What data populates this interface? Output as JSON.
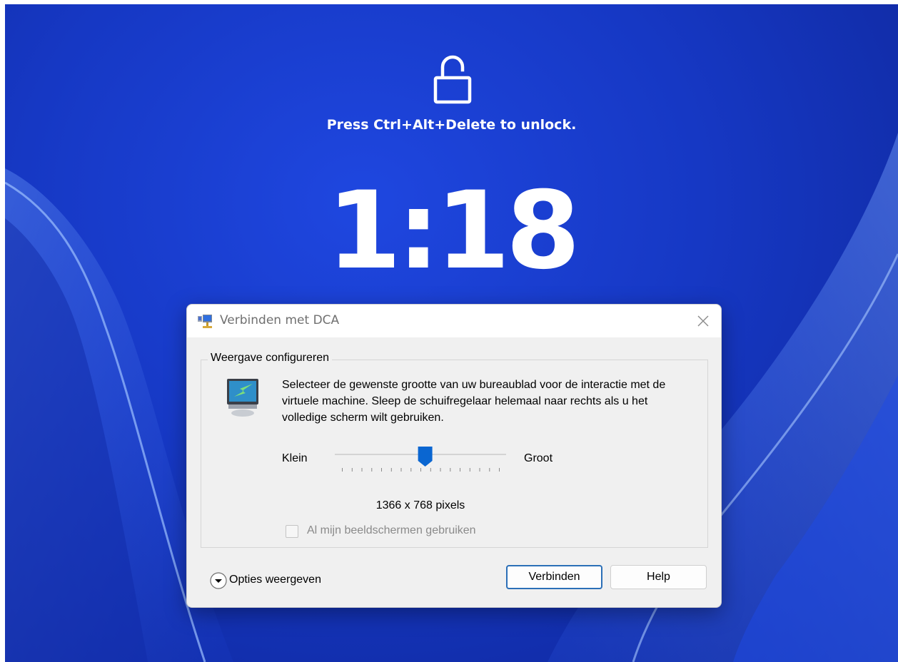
{
  "lockscreen": {
    "icon": "unlocked-padlock-icon",
    "message": "Press Ctrl+Alt+Delete to unlock.",
    "time": "1:18"
  },
  "dialog": {
    "title": "Verbinden met DCA",
    "group_title": "Weergave configureren",
    "description": "Selecteer de gewenste grootte van uw bureaublad voor de interactie met de virtuele machine. Sleep de schuifregelaar helemaal naar rechts als u het volledige scherm wilt gebruiken.",
    "slider": {
      "min_label": "Klein",
      "max_label": "Groot",
      "tick_count": 17,
      "position": 0.53
    },
    "resolution": "1366 x 768 pixels",
    "checkbox": {
      "label": "Al mijn beeldschermen gebruiken",
      "checked": false,
      "enabled": false
    },
    "options_label": "Opties weergeven",
    "buttons": {
      "connect": "Verbinden",
      "help": "Help"
    }
  },
  "colors": {
    "wallpaper": "#1638c4",
    "accent": "#2b6fb7",
    "slider_thumb": "#0a66d1"
  }
}
